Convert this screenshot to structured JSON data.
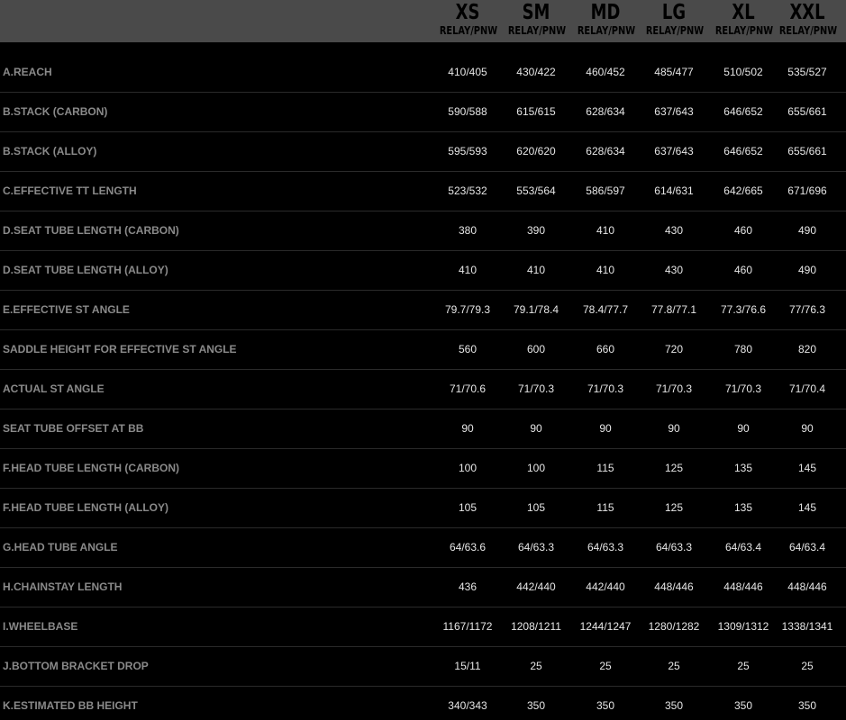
{
  "table": {
    "columns": [
      {
        "size": "XS",
        "sub": "RELAY/PNW"
      },
      {
        "size": "SM",
        "sub": "RELAY/PNW"
      },
      {
        "size": "MD",
        "sub": "RELAY/PNW"
      },
      {
        "size": "LG",
        "sub": "RELAY/PNW"
      },
      {
        "size": "XL",
        "sub": "RELAY/PNW"
      },
      {
        "size": "XXL",
        "sub": "RELAY/PNW"
      }
    ],
    "rows": [
      {
        "label": "A.REACH",
        "values": [
          "410/405",
          "430/422",
          "460/452",
          "485/477",
          "510/502",
          "535/527"
        ]
      },
      {
        "label": "B.STACK (CARBON)",
        "values": [
          "590/588",
          "615/615",
          "628/634",
          "637/643",
          "646/652",
          "655/661"
        ]
      },
      {
        "label": "B.STACK (ALLOY)",
        "values": [
          "595/593",
          "620/620",
          "628/634",
          "637/643",
          "646/652",
          "655/661"
        ]
      },
      {
        "label": "C.EFFECTIVE TT LENGTH",
        "values": [
          "523/532",
          "553/564",
          "586/597",
          "614/631",
          "642/665",
          "671/696"
        ]
      },
      {
        "label": "D.SEAT TUBE LENGTH (CARBON)",
        "values": [
          "380",
          "390",
          "410",
          "430",
          "460",
          "490"
        ]
      },
      {
        "label": "D.SEAT TUBE LENGTH (ALLOY)",
        "values": [
          "410",
          "410",
          "410",
          "430",
          "460",
          "490"
        ]
      },
      {
        "label": "E.EFFECTIVE ST ANGLE",
        "values": [
          "79.7/79.3",
          "79.1/78.4",
          "78.4/77.7",
          "77.8/77.1",
          "77.3/76.6",
          "77/76.3"
        ]
      },
      {
        "label": "SADDLE HEIGHT FOR EFFECTIVE ST ANGLE",
        "values": [
          "560",
          "600",
          "660",
          "720",
          "780",
          "820"
        ]
      },
      {
        "label": "ACTUAL ST ANGLE",
        "values": [
          "71/70.6",
          "71/70.3",
          "71/70.3",
          "71/70.3",
          "71/70.3",
          "71/70.4"
        ]
      },
      {
        "label": "SEAT TUBE OFFSET AT BB",
        "values": [
          "90",
          "90",
          "90",
          "90",
          "90",
          "90"
        ]
      },
      {
        "label": "F.HEAD TUBE LENGTH (CARBON)",
        "values": [
          "100",
          "100",
          "115",
          "125",
          "135",
          "145"
        ]
      },
      {
        "label": "F.HEAD TUBE LENGTH (ALLOY)",
        "values": [
          "105",
          "105",
          "115",
          "125",
          "135",
          "145"
        ]
      },
      {
        "label": "G.HEAD TUBE ANGLE",
        "values": [
          "64/63.6",
          "64/63.3",
          "64/63.3",
          "64/63.3",
          "64/63.4",
          "64/63.4"
        ]
      },
      {
        "label": "H.CHAINSTAY LENGTH",
        "values": [
          "436",
          "442/440",
          "442/440",
          "448/446",
          "448/446",
          "448/446"
        ]
      },
      {
        "label": "I.WHEELBASE",
        "values": [
          "1167/1172",
          "1208/1211",
          "1244/1247",
          "1280/1282",
          "1309/1312",
          "1338/1341"
        ]
      },
      {
        "label": "J.BOTTOM BRACKET DROP",
        "values": [
          "15/11",
          "25",
          "25",
          "25",
          "25",
          "25"
        ]
      },
      {
        "label": "K.ESTIMATED BB HEIGHT",
        "values": [
          "340/343",
          "350",
          "350",
          "350",
          "350",
          "350"
        ]
      }
    ]
  },
  "colors": {
    "background": "#000000",
    "header_bar": "#4a4a4a",
    "label_text": "#8a8a8a",
    "value_text": "#e6e6e6",
    "divider": "#2a2a2a"
  }
}
